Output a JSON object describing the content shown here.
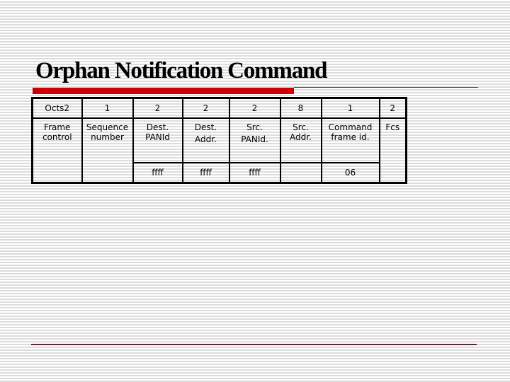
{
  "slide": {
    "title": "Orphan Notification Command",
    "accent_color": "#cc0000",
    "table": {
      "octets_row": [
        "Octs2",
        "1",
        "2",
        "2",
        "2",
        "8",
        "1",
        "2"
      ],
      "fields_row": [
        [
          "Frame",
          "control"
        ],
        [
          "Sequence",
          "number"
        ],
        [
          "Dest.",
          "PANId"
        ],
        [
          "Dest.",
          "Addr."
        ],
        [
          "Src.",
          "PANId."
        ],
        [
          "Src.",
          "Addr."
        ],
        [
          "Command",
          "frame id."
        ],
        [
          "Fcs",
          ""
        ]
      ],
      "values_row": [
        "",
        "",
        "ffff",
        "ffff",
        "ffff",
        "",
        "06",
        ""
      ]
    }
  }
}
